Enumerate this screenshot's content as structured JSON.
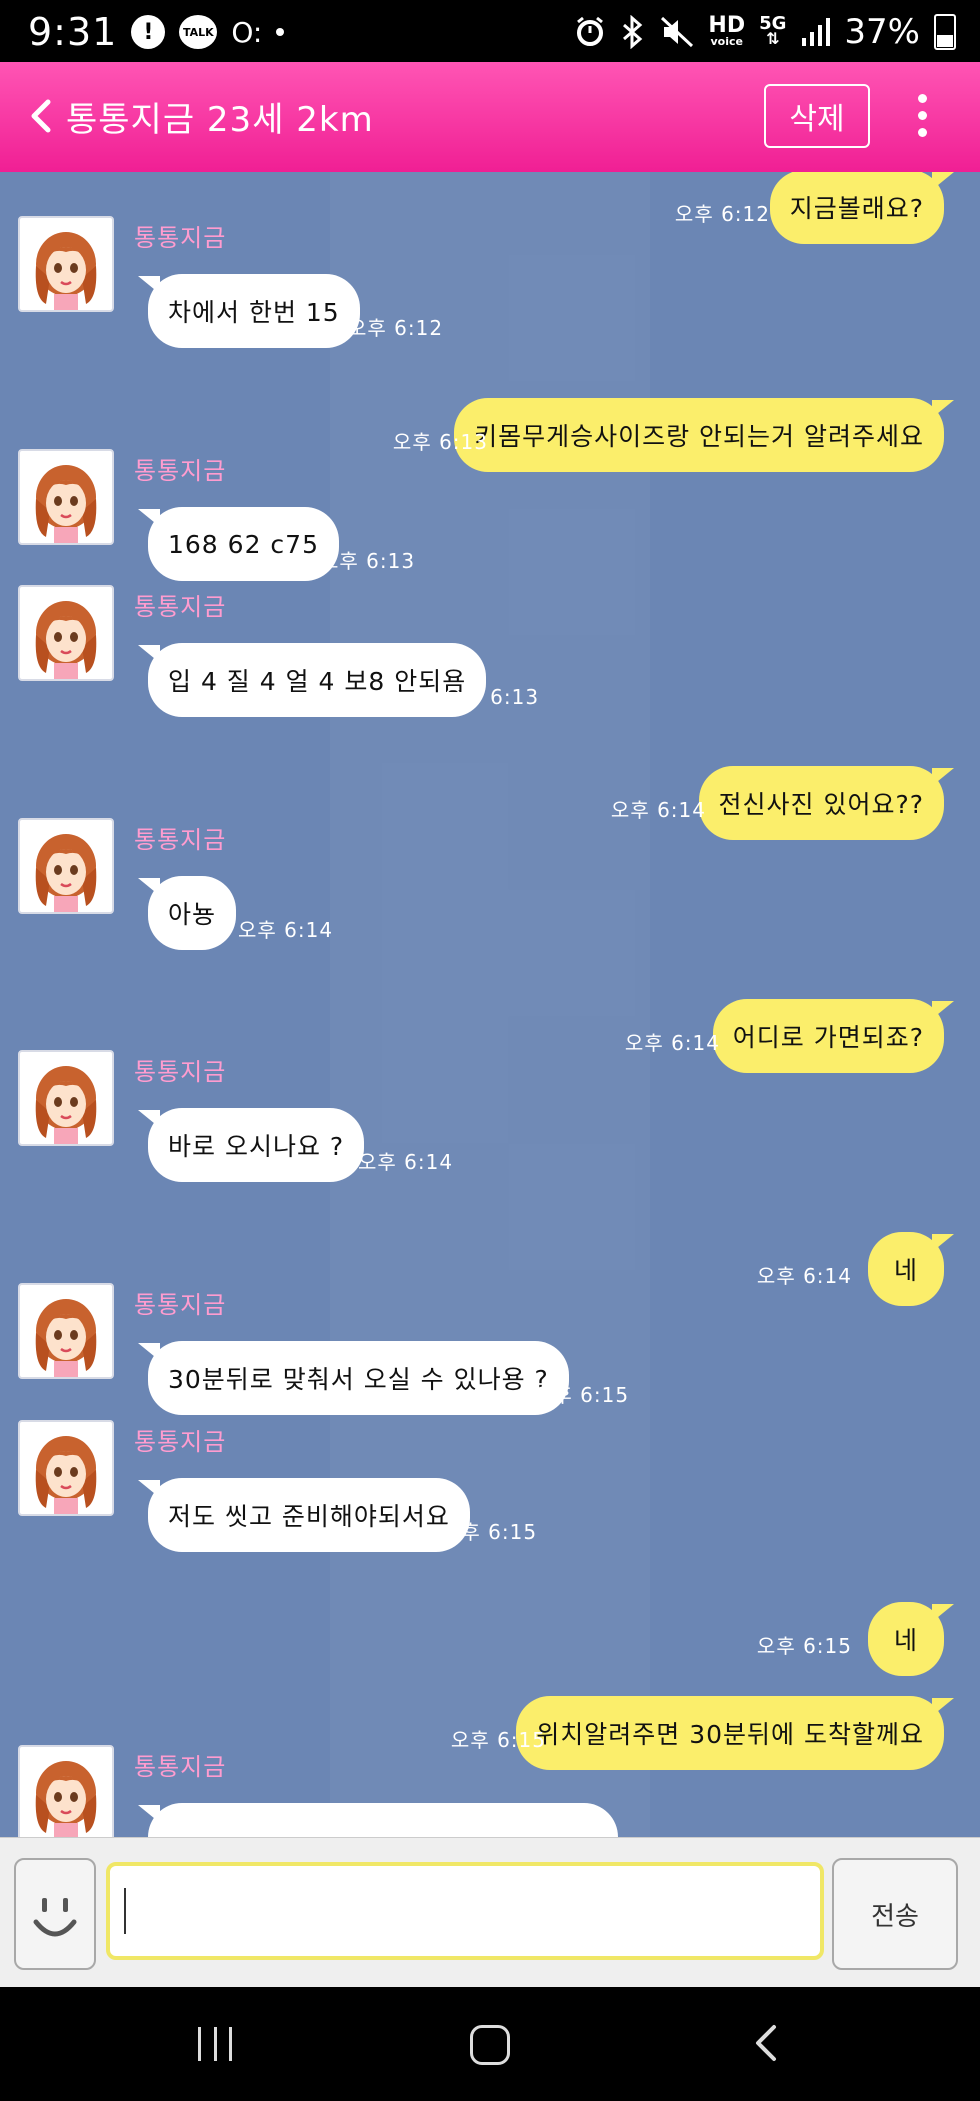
{
  "status_bar": {
    "time": "9:31",
    "alert_icon_glyph": "!",
    "talk_icon_text": "TALK",
    "misc_icon_glyph": "O:",
    "hd_label": "HD",
    "voice_label": "voice",
    "network_label": "5G",
    "battery": "37%"
  },
  "header": {
    "title": "통통지금 23세 2km",
    "delete_label": "삭제"
  },
  "messages": [
    {
      "side": "me",
      "text": "지금볼래요?",
      "time": "오후 6:12"
    },
    {
      "side": "other",
      "sender": "통통지금",
      "text": "차에서 한번 15",
      "time": "오후 6:12"
    },
    {
      "side": "me",
      "text": "키몸무게승사이즈랑 안되는거 알려주세요",
      "time": "오후 6:13"
    },
    {
      "side": "other",
      "sender": "통통지금",
      "text": "168 62 c75",
      "time": "오후 6:13"
    },
    {
      "side": "other",
      "sender": "통통지금",
      "text": "입 4 질 4 얼 4 보8 안되욤",
      "time": "오후 6:13"
    },
    {
      "side": "me",
      "text": "전신사진 있어요??",
      "time": "오후 6:14"
    },
    {
      "side": "other",
      "sender": "통통지금",
      "text": "아뇽",
      "time": "오후 6:14"
    },
    {
      "side": "me",
      "text": "어디로 가면되죠?",
      "time": "오후 6:14"
    },
    {
      "side": "other",
      "sender": "통통지금",
      "text": "바로 오시나요 ?",
      "time": "오후 6:14"
    },
    {
      "side": "me",
      "text": "네",
      "time": "오후 6:14"
    },
    {
      "side": "other",
      "sender": "통통지금",
      "text": "30분뒤로 맞춰서 오실 수 있나용 ?",
      "time": "오후 6:15"
    },
    {
      "side": "other",
      "sender": "통통지금",
      "text": "저도 씻고 준비해야되서요",
      "time": "오후 6:15"
    },
    {
      "side": "me",
      "text": "네",
      "time": "오후 6:15"
    },
    {
      "side": "me",
      "text": "위치알려주면 30분뒤에 도착할께요",
      "time": "오후 6:15"
    },
    {
      "side": "other",
      "sender": "통통지금",
      "text": "",
      "time": ""
    }
  ],
  "input": {
    "value": "",
    "send_label": "전송"
  },
  "colors": {
    "header": "#f01f94",
    "chat_bg": "#6b86b4",
    "my_bubble": "#fbee6b",
    "other_bubble": "#ffffff",
    "sender_name": "#ff9ccf"
  }
}
